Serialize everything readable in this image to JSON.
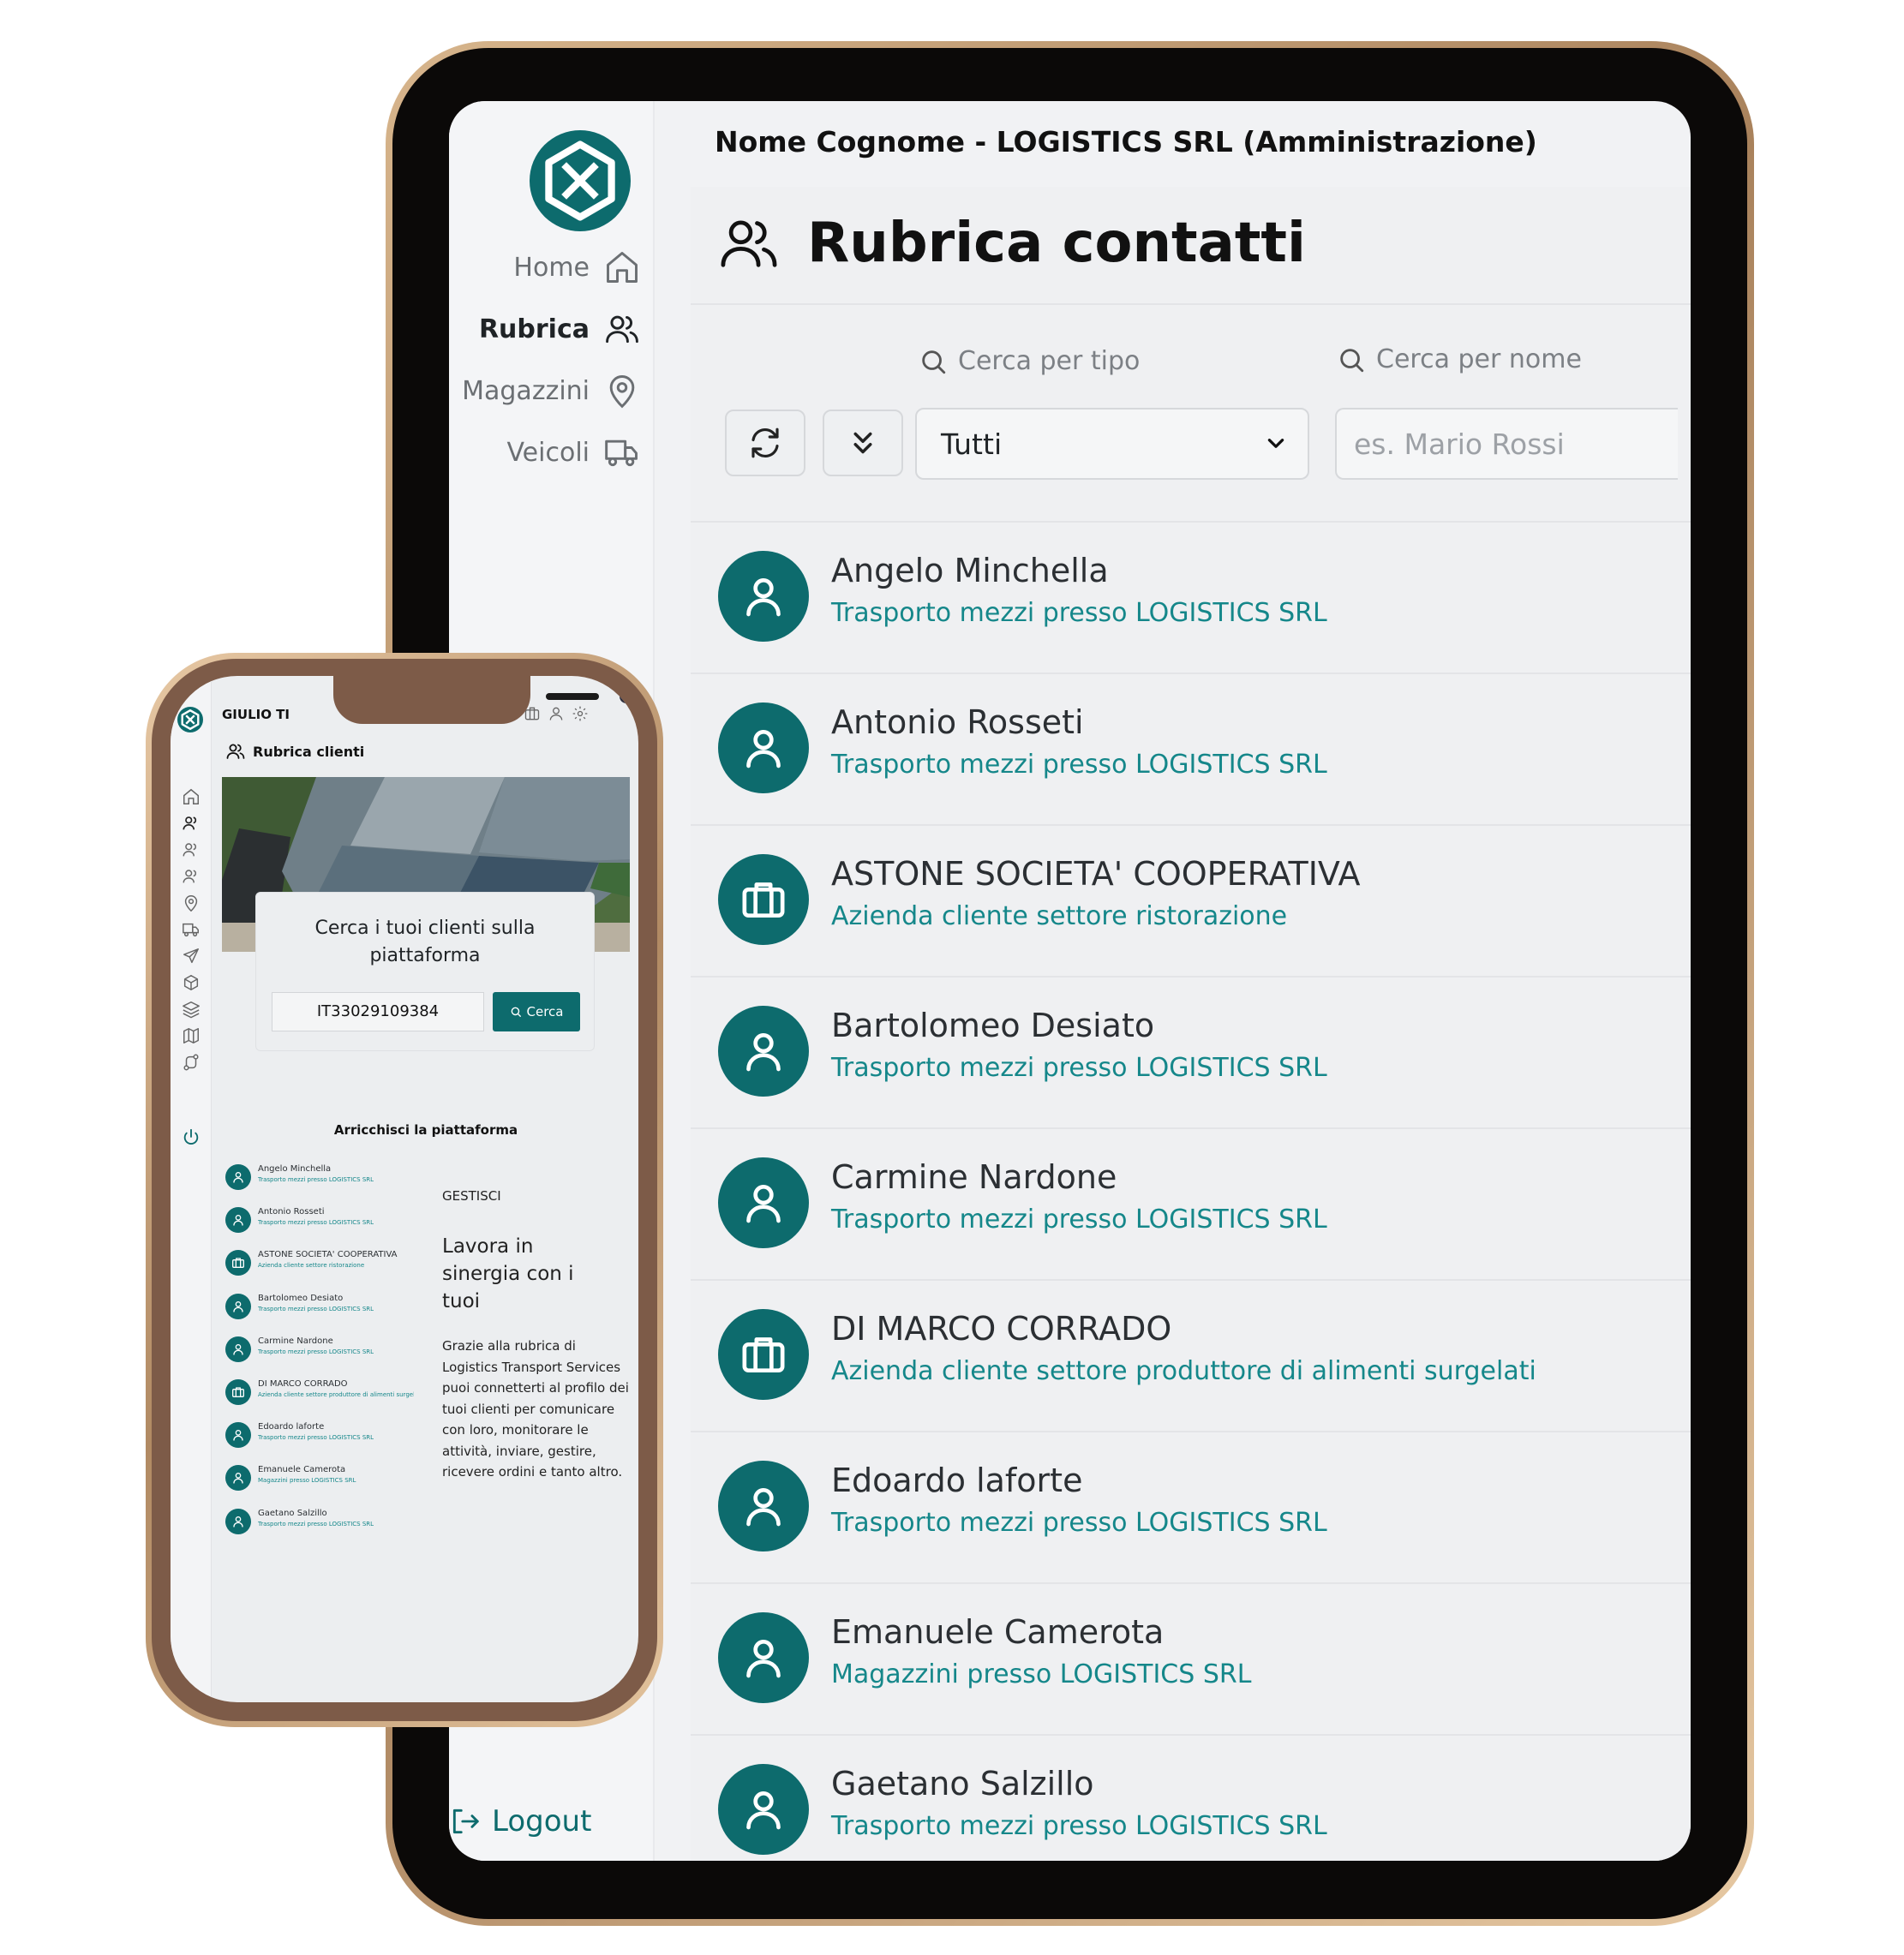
{
  "tablet": {
    "user_header": "Nome Cognome - LOGISTICS SRL (Amministrazione)",
    "nav": [
      {
        "label": "Home",
        "icon": "home-icon"
      },
      {
        "label": "Rubrica",
        "icon": "users-icon",
        "active": true
      },
      {
        "label": "Magazzini",
        "icon": "map-pin-icon"
      },
      {
        "label": "Veicoli",
        "icon": "truck-icon"
      }
    ],
    "logout_label": "Logout",
    "page_title": "Rubrica contatti",
    "filter_type_label": "Cerca per tipo",
    "filter_name_label": "Cerca per nome",
    "type_select_value": "Tutti",
    "name_placeholder": "es. Mario Rossi",
    "contacts": [
      {
        "name": "Angelo Minchella",
        "role": "Trasporto mezzi presso LOGISTICS SRL",
        "kind": "person"
      },
      {
        "name": "Antonio Rosseti",
        "role": "Trasporto mezzi presso LOGISTICS SRL",
        "kind": "person"
      },
      {
        "name": "ASTONE SOCIETA' COOPERATIVA",
        "role": "Azienda cliente settore ristorazione",
        "kind": "company"
      },
      {
        "name": "Bartolomeo Desiato",
        "role": "Trasporto mezzi presso LOGISTICS SRL",
        "kind": "person"
      },
      {
        "name": "Carmine Nardone",
        "role": "Trasporto mezzi presso LOGISTICS SRL",
        "kind": "person"
      },
      {
        "name": "DI MARCO CORRADO",
        "role": "Azienda cliente settore produttore di alimenti surgelati",
        "kind": "company"
      },
      {
        "name": "Edoardo laforte",
        "role": "Trasporto mezzi presso LOGISTICS SRL",
        "kind": "person"
      },
      {
        "name": "Emanuele Camerota",
        "role": "Magazzini presso LOGISTICS SRL",
        "kind": "person"
      },
      {
        "name": "Gaetano Salzillo",
        "role": "Trasporto mezzi presso LOGISTICS SRL",
        "kind": "person"
      }
    ]
  },
  "phone": {
    "user_header": "GIULIO TI",
    "page_title": "Rubrica clienti",
    "search_card_title": "Cerca i tuoi clienti sulla piattaforma",
    "search_value": "IT33029109384",
    "search_button": "Cerca",
    "section_title": "Arricchisci la piattaforma",
    "gestisci_label": "GESTISCI",
    "gestisci_title": "Lavora in sinergia con i tuoi",
    "gestisci_body": "Grazie alla rubrica di Logistics Transport Services puoi connetterti al profilo dei tuoi clienti per comunicare con loro, monitorare le attività, inviare, gestire, ricevere ordini e tanto altro.",
    "contacts": [
      {
        "name": "Angelo Minchella",
        "role": "Trasporto mezzi presso LOGISTICS SRL",
        "kind": "person"
      },
      {
        "name": "Antonio Rosseti",
        "role": "Trasporto mezzi presso LOGISTICS SRL",
        "kind": "person"
      },
      {
        "name": "ASTONE SOCIETA' COOPERATIVA",
        "role": "Azienda cliente settore ristorazione",
        "kind": "company"
      },
      {
        "name": "Bartolomeo Desiato",
        "role": "Trasporto mezzi presso LOGISTICS SRL",
        "kind": "person"
      },
      {
        "name": "Carmine Nardone",
        "role": "Trasporto mezzi presso LOGISTICS SRL",
        "kind": "person"
      },
      {
        "name": "DI MARCO CORRADO",
        "role": "Azienda cliente settore produttore di alimenti surgelati",
        "kind": "company"
      },
      {
        "name": "Edoardo laforte",
        "role": "Trasporto mezzi presso LOGISTICS SRL",
        "kind": "person"
      },
      {
        "name": "Emanuele Camerota",
        "role": "Magazzini presso LOGISTICS SRL",
        "kind": "person"
      },
      {
        "name": "Gaetano Salzillo",
        "role": "Trasporto mezzi presso LOGISTICS SRL",
        "kind": "person"
      }
    ]
  },
  "colors": {
    "brand_teal": "#0d6b6d",
    "subtitle_teal": "#15878a",
    "tablet_frame": "#0b0908",
    "phone_frame": "#7d5b48"
  }
}
